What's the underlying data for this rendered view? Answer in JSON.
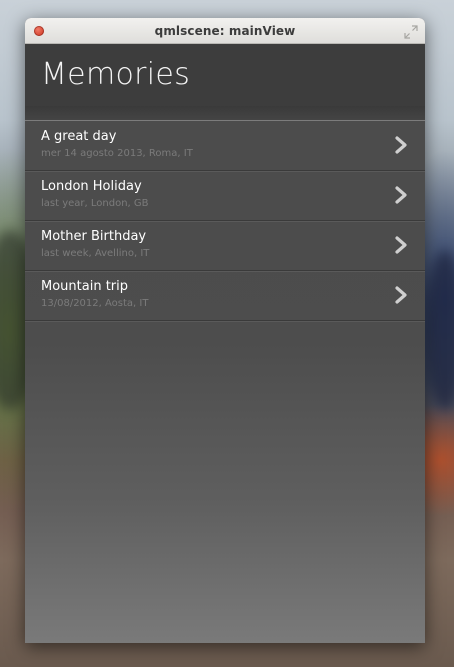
{
  "window": {
    "title": "qmlscene: mainView"
  },
  "header": {
    "title": "Memories"
  },
  "memories": [
    {
      "title": "A great day",
      "subtitle": "mer 14 agosto 2013, Roma, IT"
    },
    {
      "title": "London Holiday",
      "subtitle": "last year, London, GB"
    },
    {
      "title": "Mother Birthday",
      "subtitle": "last week, Avellino, IT"
    },
    {
      "title": "Mountain trip",
      "subtitle": "13/08/2012, Aosta, IT"
    }
  ],
  "icons": {
    "close": "close-icon",
    "maximize": "maximize-icon",
    "chevron": "chevron-right-icon"
  },
  "colors": {
    "close_button": "#d6442f",
    "header_background": "#3d3d3d",
    "list_background": "#4b4b4b",
    "title_text": "#ffffff",
    "subtitle_text": "#7b7b7b"
  }
}
